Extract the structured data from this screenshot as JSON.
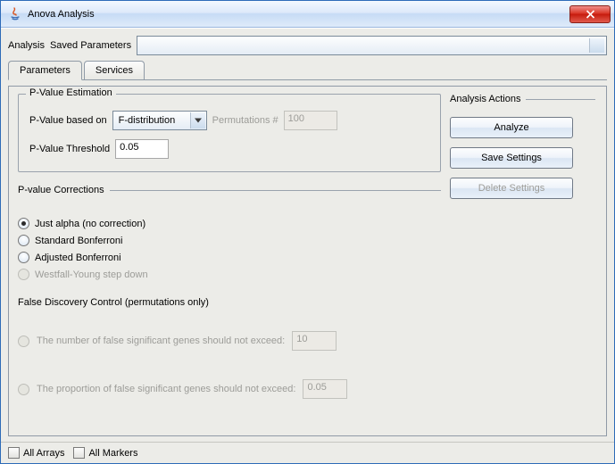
{
  "window": {
    "title": "Anova Analysis"
  },
  "toolbar": {
    "analysis_menu": "Analysis",
    "saved_params_label": "Saved Parameters",
    "saved_params_value": ""
  },
  "tabs": {
    "parameters": "Parameters",
    "services": "Services"
  },
  "pvalue_group": {
    "title": "P-Value Estimation",
    "based_label": "P-Value based on",
    "based_value": "F-distribution",
    "perm_label": "Permutations #",
    "perm_value": "100",
    "thresh_label": "P-Value Threshold",
    "thresh_value": "0.05"
  },
  "corrections": {
    "title": "P-value Corrections",
    "opt1": "Just alpha (no correction)",
    "opt2": "Standard Bonferroni",
    "opt3": "Adjusted Bonferroni",
    "opt4": "Westfall-Young step down"
  },
  "fdc": {
    "title": "False Discovery Control (permutations only)",
    "num_label": "The number of false significant genes should not exceed:",
    "num_value": "10",
    "prop_label": "The proportion of false significant genes should not exceed:",
    "prop_value": "0.05"
  },
  "actions": {
    "title": "Analysis Actions",
    "analyze": "Analyze",
    "save": "Save Settings",
    "delete": "Delete Settings"
  },
  "footer": {
    "all_arrays": "All Arrays",
    "all_markers": "All Markers"
  }
}
